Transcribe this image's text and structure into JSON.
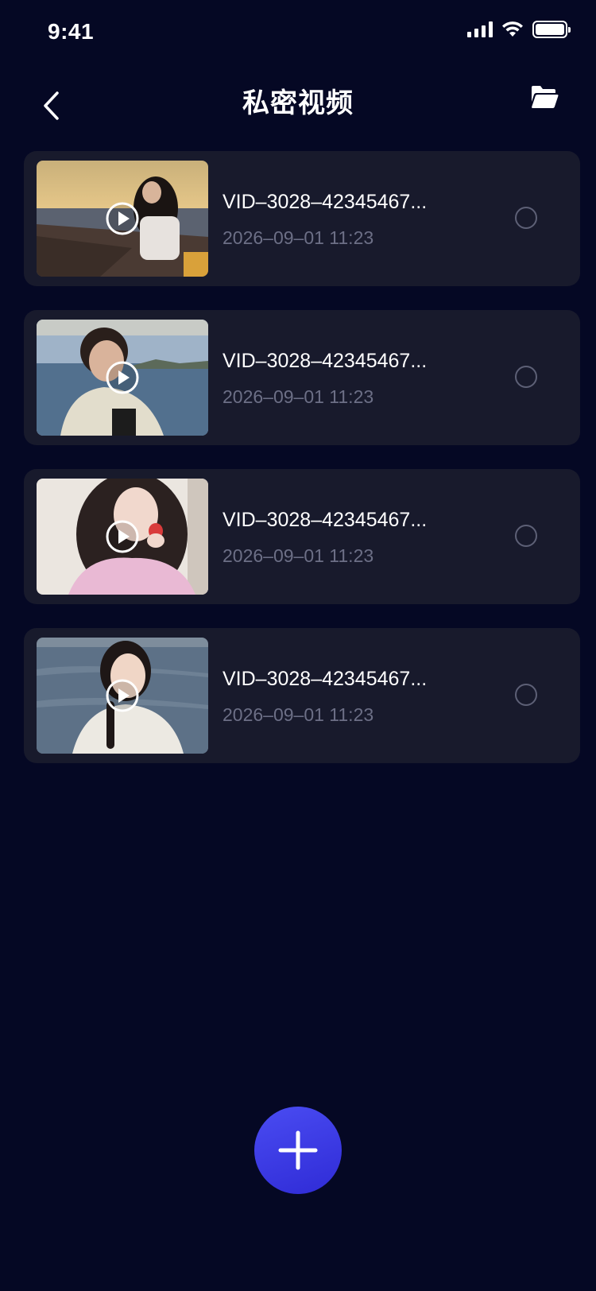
{
  "status_bar": {
    "time": "9:41"
  },
  "nav": {
    "title": "私密视频"
  },
  "videos": [
    {
      "name": "VID–3028–42345467...",
      "date": "2026–09–01 11:23",
      "thumbnail": "sunset-beach-woman"
    },
    {
      "name": "VID–3028–42345467...",
      "date": "2026–09–01 11:23",
      "thumbnail": "boy-by-sea"
    },
    {
      "name": "VID–3028–42345467...",
      "date": "2026–09–01 11:23",
      "thumbnail": "girl-with-strawberry"
    },
    {
      "name": "VID–3028–42345467...",
      "date": "2026–09–01 11:23",
      "thumbnail": "woman-by-sea"
    }
  ],
  "colors": {
    "background": "#050824",
    "card": "#181a2c",
    "accent": "#3a37e6",
    "muted_text": "#6c6f86"
  },
  "icons": [
    "back-arrow-icon",
    "folder-icon",
    "play-icon",
    "radio-unchecked-icon",
    "plus-icon"
  ]
}
